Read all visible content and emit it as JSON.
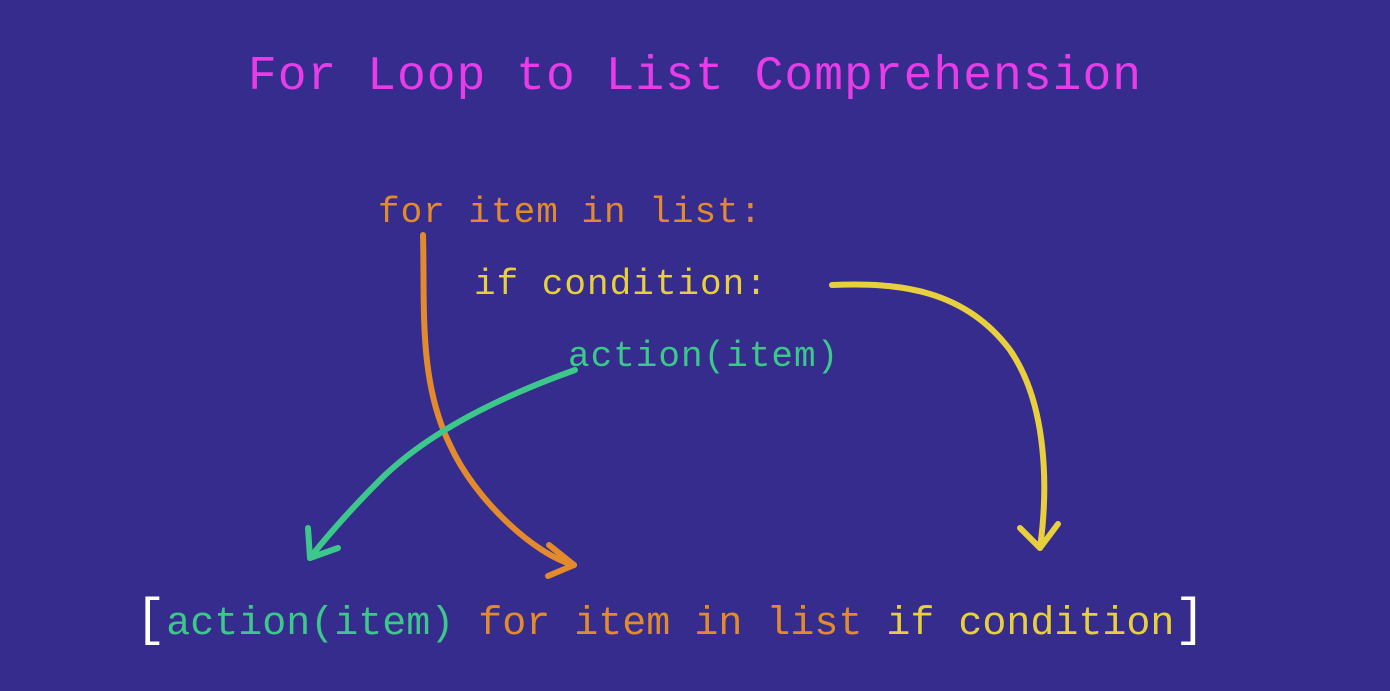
{
  "title": "For Loop to List Comprehension",
  "forloop": {
    "line1": "for item in list:",
    "line2": "if condition:",
    "line3": "action(item)"
  },
  "comprehension": {
    "open_bracket": "[",
    "action": "action(item)",
    "for_clause": "for item in list",
    "if_clause": "if condition",
    "close_bracket": "]"
  },
  "colors": {
    "background": "#352c8d",
    "title": "#e83ce8",
    "for_orange": "#e38b2c",
    "if_yellow": "#e8cf3c",
    "action_green": "#3cc88a",
    "bracket_white": "#ffffff"
  }
}
